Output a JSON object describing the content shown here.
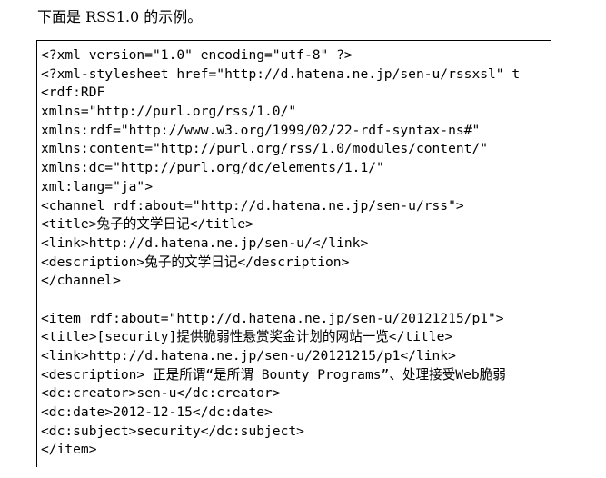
{
  "intro": "下面是 RSS1.0 的示例。",
  "code_lines": [
    "<?xml version=\"1.0\" encoding=\"utf-8\" ?>",
    "<?xml-stylesheet href=\"http://d.hatena.ne.jp/sen-u/rssxsl\" t",
    "<rdf:RDF",
    "xmlns=\"http://purl.org/rss/1.0/\"",
    "xmlns:rdf=\"http://www.w3.org/1999/02/22-rdf-syntax-ns#\"",
    "xmlns:content=\"http://purl.org/rss/1.0/modules/content/\"",
    "xmlns:dc=\"http://purl.org/dc/elements/1.1/\"",
    "xml:lang=\"ja\">",
    "<channel rdf:about=\"http://d.hatena.ne.jp/sen-u/rss\">",
    "<title>兔子的文学日记</title>",
    "<link>http://d.hatena.ne.jp/sen-u/</link>",
    "<description>兔子的文学日记</description>",
    "</channel>",
    "",
    "<item rdf:about=\"http://d.hatena.ne.jp/sen-u/20121215/p1\">",
    "<title>[security]提供脆弱性悬赏奖金计划的网站一览</title>",
    "<link>http://d.hatena.ne.jp/sen-u/20121215/p1</link>",
    "<description> 正是所谓“是所谓 Bounty Programs”、处理接受Web脆弱",
    "<dc:creator>sen-u</dc:creator>",
    "<dc:date>2012-12-15</dc:date>",
    "<dc:subject>security</dc:subject>",
    "</item>"
  ]
}
